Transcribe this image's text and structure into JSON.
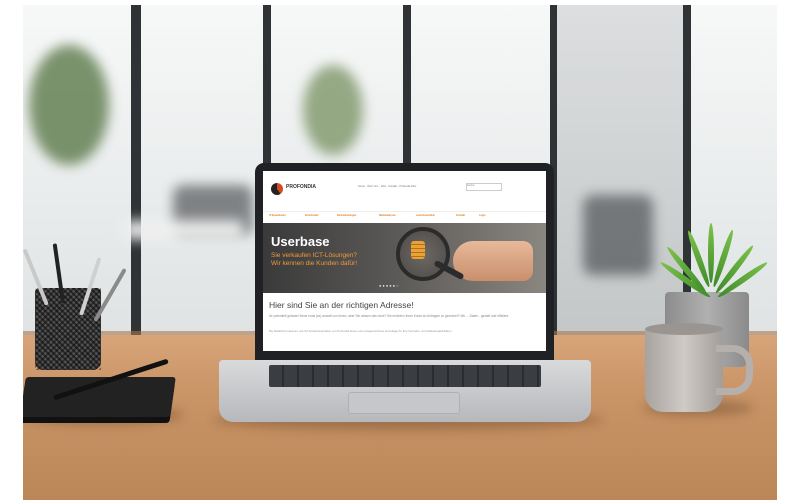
{
  "website": {
    "brand": "PROFONDIA",
    "top_nav": "Home · Über Uns · Jobs · Kontakt · Profondia Plus",
    "search_placeholder": "Suche",
    "menu": [
      "IT-Spezialisten",
      "Entscheider",
      "Dienstleistungen",
      "Marktanalysen",
      "Lead-Generation",
      "Kontakt",
      "Login"
    ],
    "hero": {
      "title": "Userbase",
      "subtitle_line1": "Sie verkaufen ICT-Lösungen?",
      "subtitle_line2": "Wir kennen die Kunden dafür!",
      "carousel_dots": "●●●●●○"
    },
    "heading": "Hier sind Sie an der richtigen Adresse!",
    "paragraph": "Ihr potentiell grösster Neue ends (es) anwalt von Ihnen, aber Sie wissen das nicht? Sie möchten Ihren Kunst an Anfragen zu geordnet? Wir ... Daten - gezielt und effizient.",
    "paragraph_small": "Die Marktinformationen und ICT-Entscheiderdaten von Profondia bieten eine ausgezeichnete Grundlage für Ihre Vertriebs- und Marketingaktivitäten."
  },
  "colors": {
    "accent": "#e07b1a",
    "hero_subtitle": "#f29a3a",
    "laptop_bezel": "#1f2124"
  }
}
